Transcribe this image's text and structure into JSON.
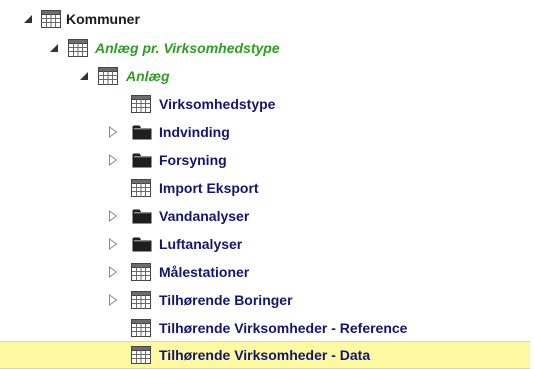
{
  "colors": {
    "black_label": "#1b1b1b",
    "green_label": "#2e9d23",
    "navy_label": "#14166e",
    "selection": "#fdf9a2"
  },
  "tree": {
    "nodes": [
      {
        "label": "Kommuner",
        "icon": "table-icon",
        "expander": "expanded",
        "style": "black"
      },
      {
        "label": "Anlæg pr. Virksomhedstype",
        "icon": "table-icon",
        "expander": "expanded",
        "style": "green"
      },
      {
        "label": "Anlæg",
        "icon": "table-icon",
        "expander": "expanded",
        "style": "green"
      },
      {
        "label": "Virksomhedstype",
        "icon": "table-icon",
        "expander": "none",
        "style": "navy"
      },
      {
        "label": "Indvinding",
        "icon": "folder-icon",
        "expander": "collapsed",
        "style": "navy"
      },
      {
        "label": "Forsyning",
        "icon": "folder-icon",
        "expander": "collapsed",
        "style": "navy"
      },
      {
        "label": "Import Eksport",
        "icon": "table-icon",
        "expander": "none",
        "style": "navy"
      },
      {
        "label": "Vandanalyser",
        "icon": "folder-icon",
        "expander": "collapsed",
        "style": "navy"
      },
      {
        "label": "Luftanalyser",
        "icon": "folder-icon",
        "expander": "collapsed",
        "style": "navy"
      },
      {
        "label": "Målestationer",
        "icon": "table-icon",
        "expander": "collapsed",
        "style": "navy"
      },
      {
        "label": "Tilhørende Boringer",
        "icon": "table-icon",
        "expander": "collapsed",
        "style": "navy"
      },
      {
        "label": "Tilhørende Virksomheder - Reference",
        "icon": "table-icon",
        "expander": "none",
        "style": "navy"
      },
      {
        "label": "Tilhørende Virksomheder - Data",
        "icon": "table-icon",
        "expander": "none",
        "style": "navy",
        "selected": true
      }
    ]
  }
}
